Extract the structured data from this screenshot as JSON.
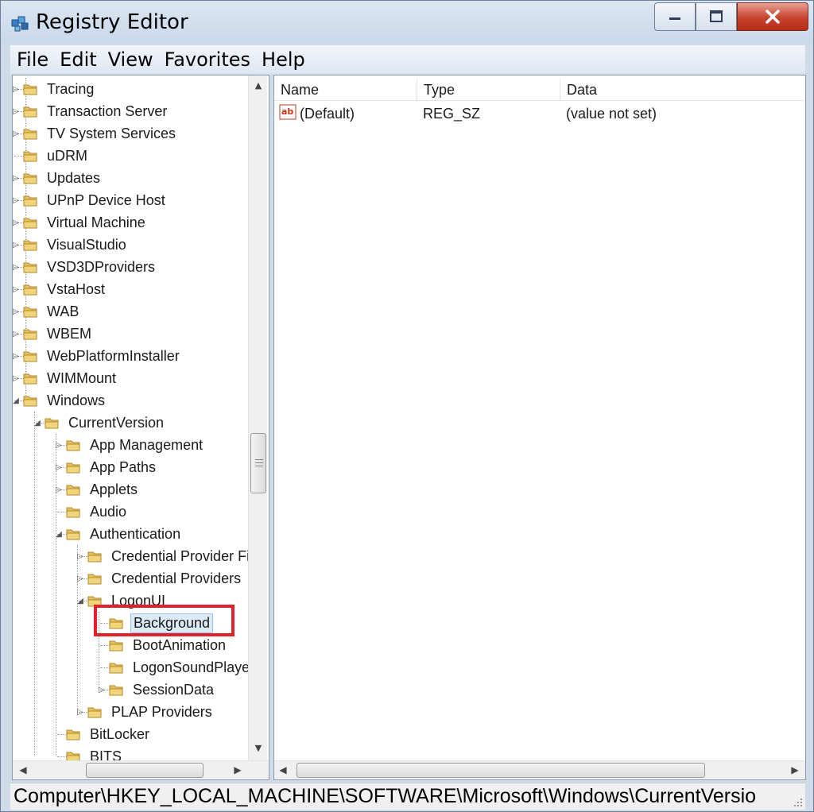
{
  "window": {
    "title": "Registry Editor",
    "minimize_glyph": "—",
    "maximize_glyph": "☐",
    "close_glyph": "✕"
  },
  "menu": [
    "File",
    "Edit",
    "View",
    "Favorites",
    "Help"
  ],
  "tree": {
    "items": [
      {
        "label": "Tracing",
        "level": 0,
        "toggle": "collapsed"
      },
      {
        "label": "Transaction Server",
        "level": 0,
        "toggle": "collapsed"
      },
      {
        "label": "TV System Services",
        "level": 0,
        "toggle": "collapsed"
      },
      {
        "label": "uDRM",
        "level": 0,
        "toggle": "none"
      },
      {
        "label": "Updates",
        "level": 0,
        "toggle": "collapsed"
      },
      {
        "label": "UPnP Device Host",
        "level": 0,
        "toggle": "collapsed"
      },
      {
        "label": "Virtual Machine",
        "level": 0,
        "toggle": "collapsed"
      },
      {
        "label": "VisualStudio",
        "level": 0,
        "toggle": "collapsed"
      },
      {
        "label": "VSD3DProviders",
        "level": 0,
        "toggle": "collapsed"
      },
      {
        "label": "VstaHost",
        "level": 0,
        "toggle": "collapsed"
      },
      {
        "label": "WAB",
        "level": 0,
        "toggle": "collapsed"
      },
      {
        "label": "WBEM",
        "level": 0,
        "toggle": "collapsed"
      },
      {
        "label": "WebPlatformInstaller",
        "level": 0,
        "toggle": "collapsed"
      },
      {
        "label": "WIMMount",
        "level": 0,
        "toggle": "collapsed"
      },
      {
        "label": "Windows",
        "level": 0,
        "toggle": "expanded"
      },
      {
        "label": "CurrentVersion",
        "level": 1,
        "toggle": "expanded"
      },
      {
        "label": "App Management",
        "level": 2,
        "toggle": "collapsed"
      },
      {
        "label": "App Paths",
        "level": 2,
        "toggle": "collapsed"
      },
      {
        "label": "Applets",
        "level": 2,
        "toggle": "collapsed"
      },
      {
        "label": "Audio",
        "level": 2,
        "toggle": "none"
      },
      {
        "label": "Authentication",
        "level": 2,
        "toggle": "expanded"
      },
      {
        "label": "Credential Provider Fil",
        "level": 3,
        "toggle": "collapsed"
      },
      {
        "label": "Credential Providers",
        "level": 3,
        "toggle": "collapsed"
      },
      {
        "label": "LogonUI",
        "level": 3,
        "toggle": "expanded"
      },
      {
        "label": "Background",
        "level": 4,
        "toggle": "none",
        "selected": true
      },
      {
        "label": "BootAnimation",
        "level": 4,
        "toggle": "none"
      },
      {
        "label": "LogonSoundPlaye",
        "level": 4,
        "toggle": "none"
      },
      {
        "label": "SessionData",
        "level": 4,
        "toggle": "collapsed"
      },
      {
        "label": "PLAP Providers",
        "level": 3,
        "toggle": "collapsed"
      },
      {
        "label": "BitLocker",
        "level": 2,
        "toggle": "none"
      },
      {
        "label": "BITS",
        "level": 2,
        "toggle": "none"
      }
    ]
  },
  "list": {
    "columns": [
      "Name",
      "Type",
      "Data"
    ],
    "rows": [
      {
        "name": "(Default)",
        "type": "REG_SZ",
        "data": "(value not set)",
        "icon": "string-value-icon"
      }
    ]
  },
  "status_bar": {
    "path": "Computer\\HKEY_LOCAL_MACHINE\\SOFTWARE\\Microsoft\\Windows\\CurrentVersio"
  },
  "colors": {
    "highlight_box": "#e1222b",
    "selection_bg": "#ddeaf8",
    "folder": "#e8c15a"
  }
}
